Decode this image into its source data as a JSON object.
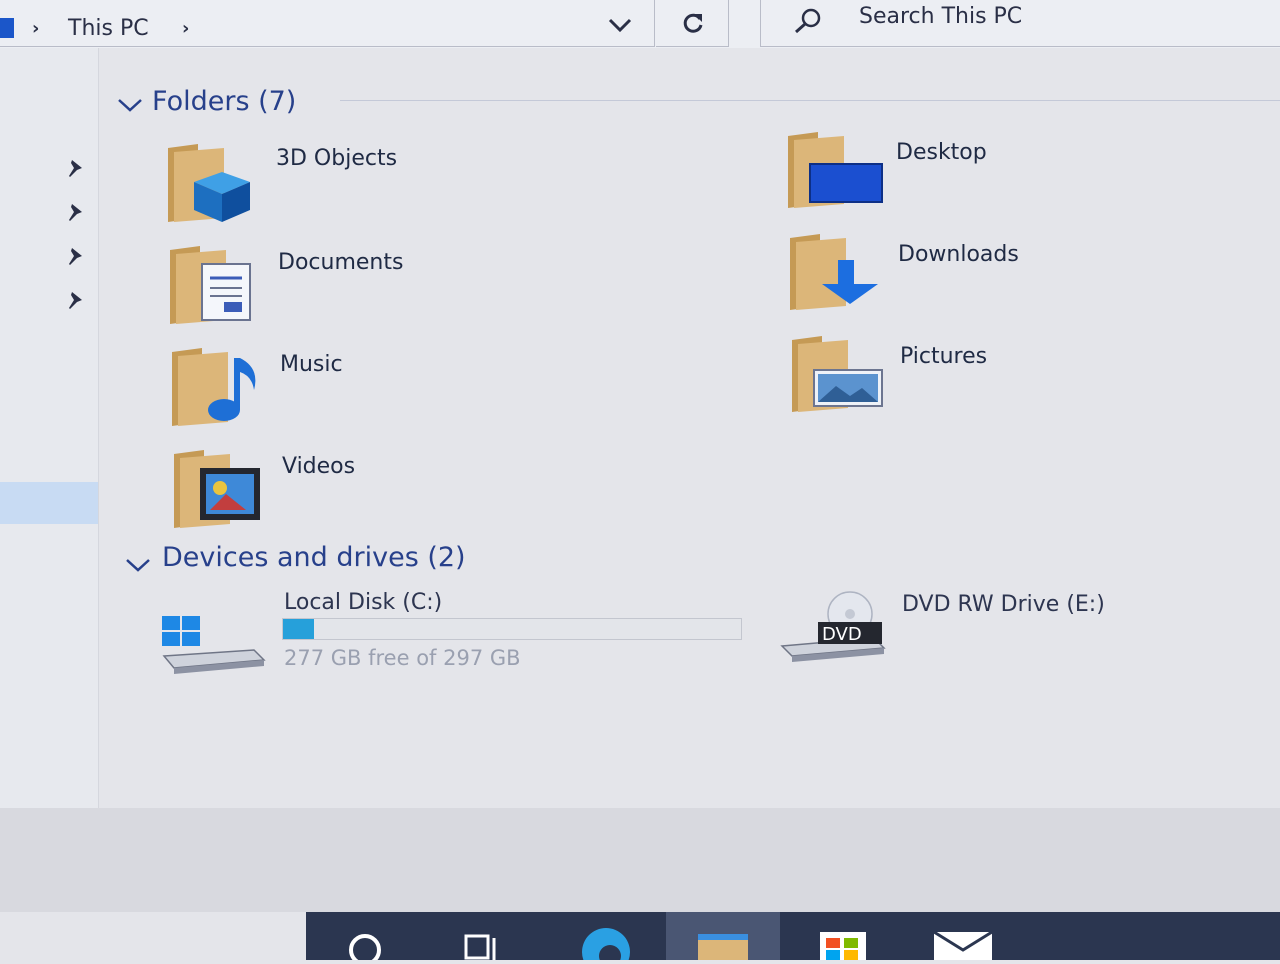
{
  "address_bar": {
    "breadcrumb": "This PC",
    "search_placeholder": "Search This PC"
  },
  "folders_group": {
    "title": "Folders (7)",
    "items": [
      {
        "label": "3D Objects"
      },
      {
        "label": "Desktop"
      },
      {
        "label": "Documents"
      },
      {
        "label": "Downloads"
      },
      {
        "label": "Music"
      },
      {
        "label": "Pictures"
      },
      {
        "label": "Videos"
      }
    ]
  },
  "devices_group": {
    "title": "Devices and drives (2)",
    "drives": [
      {
        "label": "Local Disk (C:)",
        "free_text": "277 GB free of 297 GB",
        "used_fraction": 0.067
      },
      {
        "label": "DVD RW Drive (E:)",
        "badge": "DVD"
      }
    ]
  },
  "colors": {
    "accent": "#27408b",
    "drive_fill": "#26a0da",
    "taskbar": "#2b3650",
    "folder": "#dcb679"
  },
  "taskbar": {
    "icons": [
      "search-icon",
      "task-view-icon",
      "edge-icon",
      "file-explorer-icon",
      "store-icon",
      "mail-icon"
    ]
  }
}
